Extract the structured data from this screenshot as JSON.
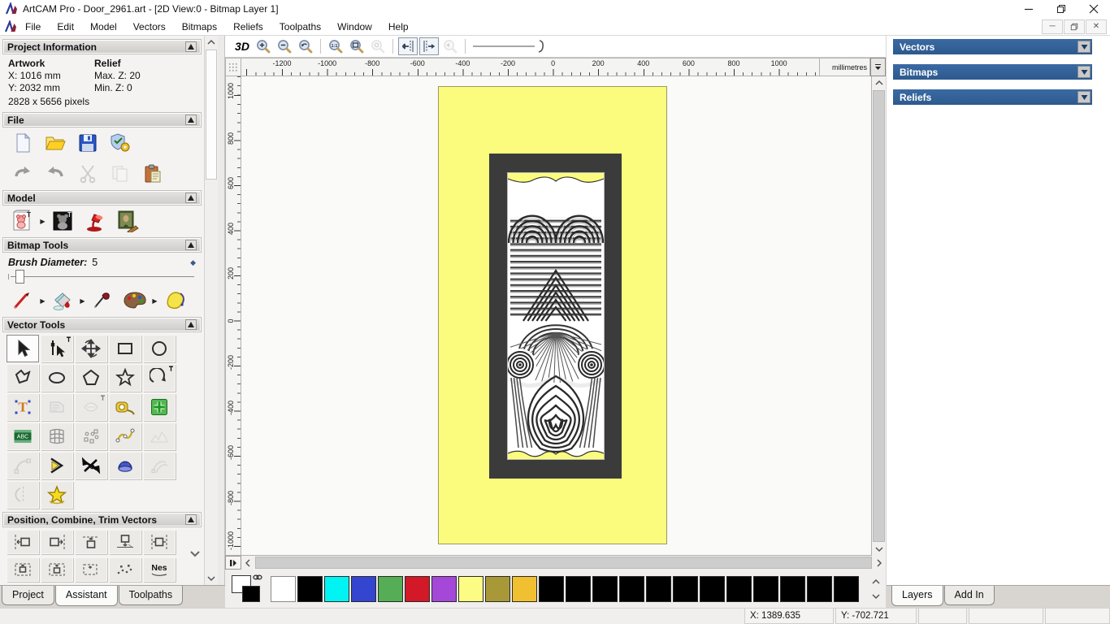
{
  "window": {
    "title": "ArtCAM Pro - Door_2961.art - [2D View:0 - Bitmap Layer 1]",
    "controls": [
      "minimize",
      "restore",
      "close"
    ],
    "mdi_controls": [
      "minimize",
      "restore",
      "close"
    ]
  },
  "menu": {
    "items": [
      "File",
      "Edit",
      "Model",
      "Vectors",
      "Bitmaps",
      "Reliefs",
      "Toolpaths",
      "Window",
      "Help"
    ]
  },
  "left_panel": {
    "project_information": {
      "title": "Project Information",
      "artwork_label": "Artwork",
      "relief_label": "Relief",
      "artwork_x": "X: 1016 mm",
      "relief_max": "Max. Z: 20",
      "artwork_y": "Y: 2032 mm",
      "relief_min": "Min. Z: 0",
      "pixels": "2828 x 5656 pixels"
    },
    "file_section": {
      "title": "File",
      "row1": [
        {
          "name": "new-model"
        },
        {
          "name": "open-model"
        },
        {
          "name": "save-model"
        },
        {
          "name": "model-notes"
        }
      ],
      "row2": [
        {
          "name": "undo"
        },
        {
          "name": "redo"
        },
        {
          "name": "cut",
          "state": "disabled"
        },
        {
          "name": "copy",
          "state": "disabled"
        },
        {
          "name": "paste"
        }
      ]
    },
    "model_section": {
      "title": "Model",
      "tools": [
        {
          "name": "sketch-model",
          "flyout": true
        },
        {
          "name": "greyscale-preview"
        },
        {
          "name": "set-lighting"
        },
        {
          "name": "load-bitmap"
        }
      ]
    },
    "bitmap_section": {
      "title": "Bitmap Tools",
      "brush_diameter_label": "Brush Diameter:",
      "brush_diameter_value": "5",
      "tools": [
        {
          "name": "paint-bitmap",
          "flyout": true
        },
        {
          "name": "flood-fill",
          "flyout": true
        },
        {
          "name": "pick-colour"
        },
        {
          "name": "colour-palette",
          "flyout": true
        },
        {
          "name": "flood-fill-tolerance"
        }
      ]
    },
    "vector_section": {
      "title": "Vector Tools",
      "tools": [
        {
          "name": "select-vectors",
          "state": "active"
        },
        {
          "name": "node-editing",
          "pin": true
        },
        {
          "name": "transform-vectors"
        },
        {
          "name": "create-rectangle"
        },
        {
          "name": "create-circle"
        },
        {
          "name": "create-polyline"
        },
        {
          "name": "create-ellipse"
        },
        {
          "name": "create-polygon"
        },
        {
          "name": "create-star"
        },
        {
          "name": "create-arc",
          "pin": true
        },
        {
          "name": "create-text"
        },
        {
          "name": "wrap-text",
          "state": "disabled"
        },
        {
          "name": "text-on-curve",
          "state": "disabled",
          "pin": true
        },
        {
          "name": "measure"
        },
        {
          "name": "paste-centre"
        },
        {
          "name": "text-block"
        },
        {
          "name": "envelope-distort"
        },
        {
          "name": "block-paste"
        },
        {
          "name": "fit-curve"
        },
        {
          "name": "free-relief",
          "state": "disabled"
        },
        {
          "name": "fit-arcs",
          "state": "disabled"
        },
        {
          "name": "join-vectors"
        },
        {
          "name": "trim-vectors"
        },
        {
          "name": "extrude"
        },
        {
          "name": "two-rail-sweep",
          "state": "disabled"
        },
        {
          "name": "mirror-vectors",
          "state": "disabled"
        },
        {
          "name": "offset-vectors"
        }
      ]
    },
    "position_section": {
      "title": "Position, Combine, Trim Vectors",
      "row1": [
        "align-left-edge",
        "align-right-edge",
        "align-top-edge",
        "align-bottom-edge",
        "align-centre-width"
      ],
      "row2": [
        "centre-in-page",
        "align-centre",
        "paste-along-curve",
        "spread-vectors",
        "nesting"
      ],
      "nesting_label": "Nes"
    },
    "tabs": [
      "Project",
      "Assistant",
      "Toolpaths"
    ],
    "active_tab": "Assistant"
  },
  "canvas_toolbar": {
    "view_3d_label": "3D",
    "buttons": [
      {
        "name": "view-3d",
        "label": "3D"
      },
      {
        "name": "zoom-in"
      },
      {
        "name": "zoom-out"
      },
      {
        "name": "zoom-previous"
      },
      {
        "sep": true
      },
      {
        "name": "zoom-scale"
      },
      {
        "name": "zoom-fit"
      },
      {
        "name": "zoom-object",
        "state": "disabled"
      },
      {
        "sep": true
      },
      {
        "name": "pan-left",
        "state": "toggled"
      },
      {
        "name": "pan-right",
        "state": "toggled"
      },
      {
        "name": "zoom-selected",
        "state": "disabled"
      },
      {
        "sep": true
      },
      {
        "name": "zoom-slider"
      }
    ]
  },
  "canvas": {
    "h_ruler_labels": [
      "-1200",
      "-1000",
      "-800",
      "-600",
      "-400",
      "-200",
      "0",
      "200",
      "400",
      "600",
      "800",
      "1000"
    ],
    "v_ruler_labels": [
      "1000",
      "800",
      "600",
      "400",
      "200",
      "0",
      "-200",
      "-400",
      "-600",
      "-800",
      "-1000"
    ],
    "units": "millimetres",
    "artwork_background": "#fbfb7e",
    "frame_color": "#3b3b3b"
  },
  "right_panel": {
    "sections": [
      "Vectors",
      "Bitmaps",
      "Reliefs"
    ],
    "tabs": [
      "Layers",
      "Add In"
    ],
    "active_tab": "Layers",
    "header_color": "#2d5a8e"
  },
  "palette": {
    "primary": "#ffffff",
    "secondary": "#000000",
    "swatches": [
      "#ffffff",
      "#000000",
      "#00f4f4",
      "#3445cf",
      "#55ae55",
      "#d31827",
      "#a548d8",
      "#fcfc84",
      "#a89838",
      "#f0c030",
      "#000000",
      "#000000",
      "#000000",
      "#000000",
      "#000000",
      "#000000",
      "#000000",
      "#000000",
      "#000000",
      "#000000",
      "#000000",
      "#000000"
    ]
  },
  "status_bar": {
    "x": "X: 1389.635",
    "y": "Y: -702.721",
    "extra_cells": [
      "",
      "",
      ""
    ]
  }
}
